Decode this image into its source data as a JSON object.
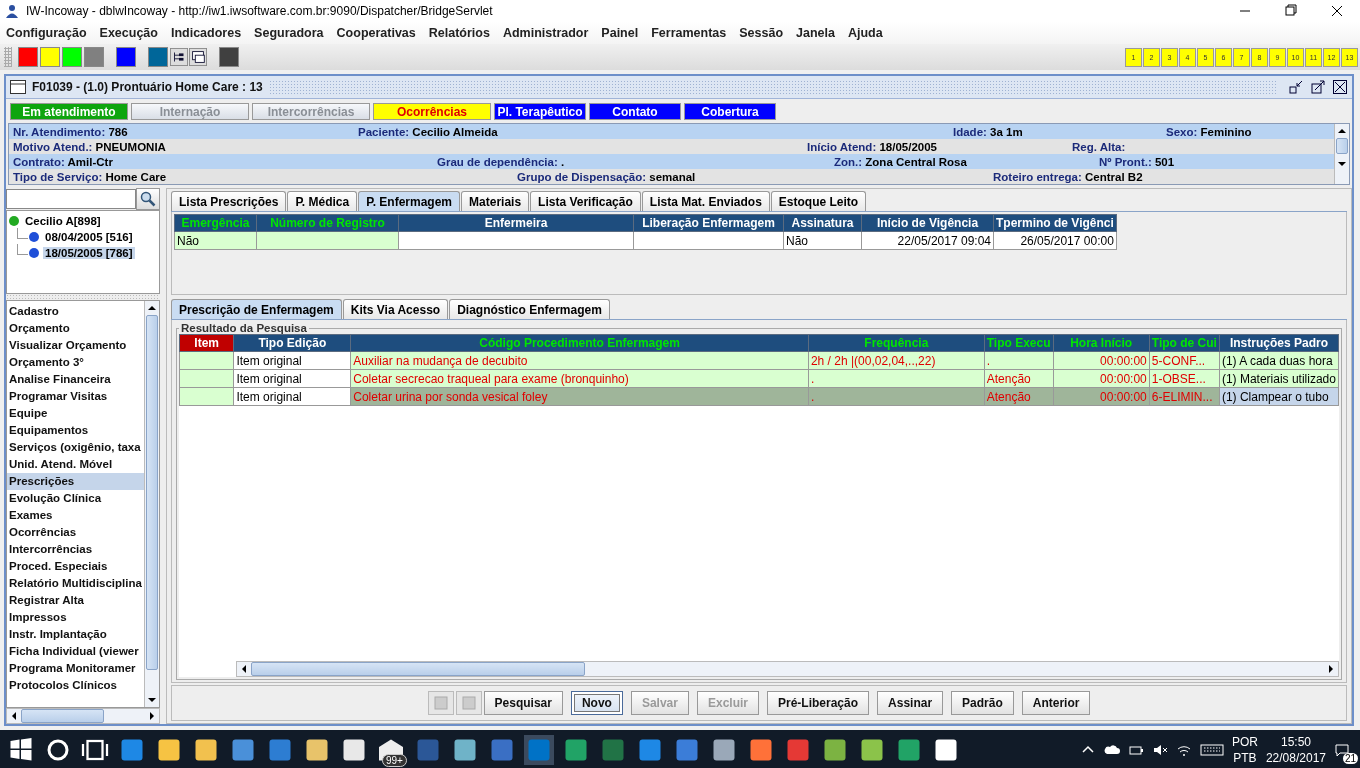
{
  "window": {
    "title": "IW-Incoway - dblwIncoway - http://iw1.iwsoftware.com.br:9090/Dispatcher/BridgeServlet"
  },
  "menu": [
    "Configuração",
    "Execução",
    "Indicadores",
    "Seguradora",
    "Cooperativas",
    "Relatórios",
    "Administrador",
    "Painel",
    "Ferramentas",
    "Sessão",
    "Janela",
    "Ajuda"
  ],
  "toolbar": {
    "color_buttons": [
      {
        "color": "#ff0000"
      },
      {
        "color": "#ffff00"
      },
      {
        "color": "#00ff00"
      },
      {
        "color": "#808080"
      },
      {
        "color": "#0000ff"
      },
      {
        "color": "#006699"
      },
      {
        "color": "#404040"
      }
    ],
    "numbered_buttons": [
      "1",
      "2",
      "3",
      "4",
      "5",
      "6",
      "7",
      "8",
      "9",
      "10",
      "11",
      "12",
      "13"
    ]
  },
  "frame": {
    "title": "F01039 - (1.0) Prontuário Home Care : 13"
  },
  "status_buttons": [
    {
      "label": "Em atendimento",
      "kind": "active"
    },
    {
      "label": "Internação",
      "kind": "disabled"
    },
    {
      "label": "Intercorrências",
      "kind": "disabled"
    },
    {
      "label": "Ocorrências",
      "kind": "warning"
    },
    {
      "label": "Pl. Terapêutico",
      "kind": "info"
    },
    {
      "label": "Contato",
      "kind": "info"
    },
    {
      "label": "Cobertura",
      "kind": "info"
    }
  ],
  "patient_info": [
    {
      "fields": [
        {
          "label": "Nr. Atendimento:",
          "value": "786"
        },
        {
          "label": "Paciente:",
          "value": "Cecilio Almeida"
        },
        {
          "label": "Idade:",
          "value": "3a 1m"
        },
        {
          "label": "Sexo:",
          "value": "Feminino"
        }
      ]
    },
    {
      "fields": [
        {
          "label": "Motivo Atend.:",
          "value": "PNEUMONIA"
        },
        {
          "label": "Início Atend:",
          "value": "18/05/2005"
        },
        {
          "label": "Reg. Alta:"
        }
      ]
    },
    {
      "fields": [
        {
          "label": "Contrato:",
          "value": "Amil-Ctr"
        },
        {
          "label": "Grau de dependência:",
          "value": "."
        },
        {
          "label": "Zon.:",
          "value": "Zona Central Rosa"
        },
        {
          "label": "Nº Pront.:",
          "value": "501"
        }
      ]
    },
    {
      "fields": [
        {
          "label": "Tipo de Serviço:",
          "value": "Home Care"
        },
        {
          "label": "Grupo de Dispensação:",
          "value": "semanal"
        },
        {
          "label": "Roteiro entrega:",
          "value": "Central B2"
        }
      ]
    }
  ],
  "tree": [
    {
      "label": "Cecilio A[898]",
      "color": "#22aa22",
      "selected": false,
      "children": [
        {
          "label": "08/04/2005 [516]",
          "color": "#1f4fd8",
          "selected": false
        },
        {
          "label": "18/05/2005 [786]",
          "color": "#1f4fd8",
          "selected": true
        }
      ]
    }
  ],
  "side_menu": [
    {
      "label": "Cadastro",
      "selected": false
    },
    {
      "label": "Orçamento",
      "selected": false
    },
    {
      "label": "Visualizar Orçamento",
      "selected": false
    },
    {
      "label": "Orçamento 3°",
      "selected": false
    },
    {
      "label": "Analise Financeira",
      "selected": false
    },
    {
      "label": "Programar Visitas",
      "selected": false
    },
    {
      "label": "Equipe",
      "selected": false
    },
    {
      "label": "Equipamentos",
      "selected": false
    },
    {
      "label": "Serviços (oxigênio, taxa",
      "selected": false
    },
    {
      "label": "Unid. Atend. Móvel",
      "selected": false
    },
    {
      "label": "Prescrições",
      "selected": true
    },
    {
      "label": "Evolução Clínica",
      "selected": false
    },
    {
      "label": "Exames",
      "selected": false
    },
    {
      "label": "Ocorrências",
      "selected": false
    },
    {
      "label": "Intercorrências",
      "selected": false
    },
    {
      "label": "Proced. Especiais",
      "selected": false
    },
    {
      "label": "Relatório Multidisciplina",
      "selected": false
    },
    {
      "label": "Registrar Alta",
      "selected": false
    },
    {
      "label": "Impressos",
      "selected": false
    },
    {
      "label": "Instr. Implantação",
      "selected": false
    },
    {
      "label": "Ficha Individual (viewer",
      "selected": false
    },
    {
      "label": "Programa Monitoramer",
      "selected": false
    },
    {
      "label": "Protocolos Clínicos",
      "selected": false
    }
  ],
  "tabs": [
    {
      "label": "Lista Prescrições",
      "selected": false
    },
    {
      "label": "P. Médica",
      "selected": false
    },
    {
      "label": "P. Enfermagem",
      "selected": true
    },
    {
      "label": "Materiais",
      "selected": false
    },
    {
      "label": "Lista Verificação",
      "selected": false
    },
    {
      "label": "Lista Mat. Enviados",
      "selected": false
    },
    {
      "label": "Estoque Leito",
      "selected": false
    }
  ],
  "registration_table": {
    "columns": [
      {
        "label": "Emergência",
        "kind": "highlight"
      },
      {
        "label": "Número de Registro",
        "kind": "highlight"
      },
      {
        "label": "Enfermeira",
        "kind": "plain"
      },
      {
        "label": "Liberação Enfermagem",
        "kind": "plain"
      },
      {
        "label": "Assinatura",
        "kind": "plain"
      },
      {
        "label": "Início de Vigência",
        "kind": "plain"
      },
      {
        "label": "Tpermino de Vigênci",
        "kind": "plain"
      }
    ],
    "rows": [
      [
        "Não",
        null,
        null,
        null,
        "Não",
        "22/05/2017 09:04",
        "26/05/2017 00:00"
      ]
    ]
  },
  "subtabs": [
    {
      "label": "Prescrição de Enfermagem",
      "selected": true
    },
    {
      "label": "Kits Via Acesso",
      "selected": false
    },
    {
      "label": "Diagnóstico Enfermagem",
      "selected": false
    }
  ],
  "results": {
    "title": "Resultado da Pesquisa",
    "columns": [
      {
        "label": "Item",
        "kind": "key"
      },
      {
        "label": "Tipo Edição",
        "kind": "plain",
        "alert": false
      },
      {
        "label": "Código Procedimento Enfermagem",
        "kind": "highlight",
        "alert": true
      },
      {
        "label": "Frequência",
        "kind": "highlight",
        "alert": true
      },
      {
        "label": "Tipo Execu",
        "kind": "highlight",
        "alert": true
      },
      {
        "label": "Hora Início",
        "kind": "highlight",
        "alert": true
      },
      {
        "label": "Tipo de Cui",
        "kind": "highlight",
        "alert": true
      },
      {
        "label": "Instruções Padro",
        "kind": "plain",
        "alert": false
      }
    ],
    "rows": [
      {
        "selected": false,
        "cells": [
          null,
          "Item original",
          "Auxiliar na mudança de decubito",
          "2h / 2h |(00,02,04,..,22)",
          ".",
          "00:00:00",
          "5-CONF...",
          "(1) A cada duas hora"
        ]
      },
      {
        "selected": false,
        "cells": [
          null,
          "Item original",
          "Coletar secrecao traqueal para exame (bronquinho)",
          ".",
          "Atenção",
          "00:00:00",
          "1-OBSE...",
          "(1) Materiais utilizado"
        ]
      },
      {
        "selected": true,
        "cells": [
          null,
          "Item original",
          "Coletar urina por sonda vesical foley",
          ".",
          "Atenção",
          "00:00:00",
          "6-ELIMIN...",
          "(1) Clampear o tubo"
        ]
      }
    ]
  },
  "buttons": [
    {
      "kind": "icon",
      "disabled": true
    },
    {
      "kind": "icon",
      "disabled": true
    },
    {
      "kind": "text",
      "label": "Pesquisar",
      "disabled": false,
      "focused": false
    },
    {
      "kind": "text",
      "label": "Novo",
      "disabled": false,
      "focused": true
    },
    {
      "kind": "text",
      "label": "Salvar",
      "disabled": true,
      "focused": false
    },
    {
      "kind": "text",
      "label": "Excluir",
      "disabled": true,
      "focused": false
    },
    {
      "kind": "text",
      "label": "Pré-Liberação",
      "disabled": false,
      "focused": false
    },
    {
      "kind": "text",
      "label": "Assinar",
      "disabled": false,
      "focused": false
    },
    {
      "kind": "text",
      "label": "Padrão",
      "disabled": false,
      "focused": false
    },
    {
      "kind": "text",
      "label": "Anterior",
      "disabled": false,
      "focused": false
    }
  ],
  "taskbar": {
    "mail_badge": "99+",
    "language": "POR",
    "layout": "PTB",
    "time": "15:50",
    "date": "22/08/2017",
    "notifications": "21"
  }
}
